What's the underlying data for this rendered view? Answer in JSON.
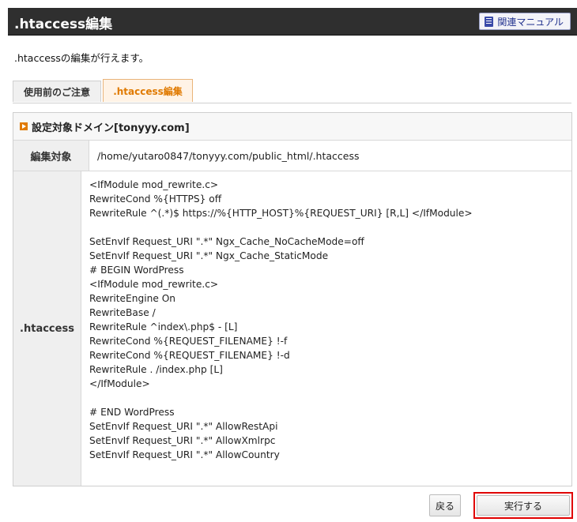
{
  "header": {
    "title": ".htaccess編集",
    "manual_label": "関連マニュアル"
  },
  "description": ".htaccessの編集が行えます。",
  "tabs": [
    {
      "label": "使用前のご注意",
      "active": false
    },
    {
      "label": ".htaccess編集",
      "active": true
    }
  ],
  "panel": {
    "title": "設定対象ドメイン[tonyyy.com]",
    "target_label": "編集対象",
    "target_path": "/home/yutaro0847/tonyyy.com/public_html/.htaccess",
    "htaccess_label": ".htaccess",
    "htaccess_content": "<IfModule mod_rewrite.c>\nRewriteCond %{HTTPS} off\nRewriteRule ^(.*)$ https://%{HTTP_HOST}%{REQUEST_URI} [R,L] </IfModule>\n\nSetEnvIf Request_URI \".*\" Ngx_Cache_NoCacheMode=off\nSetEnvIf Request_URI \".*\" Ngx_Cache_StaticMode\n# BEGIN WordPress\n<IfModule mod_rewrite.c>\nRewriteEngine On\nRewriteBase /\nRewriteRule ^index\\.php$ - [L]\nRewriteCond %{REQUEST_FILENAME} !-f\nRewriteCond %{REQUEST_FILENAME} !-d\nRewriteRule . /index.php [L]\n</IfModule>\n\n# END WordPress\nSetEnvIf Request_URI \".*\" AllowRestApi\nSetEnvIf Request_URI \".*\" AllowXmlrpc\nSetEnvIf Request_URI \".*\" AllowCountry"
  },
  "buttons": {
    "back_label": "戻る",
    "execute_label": "実行する"
  },
  "icons": {
    "manual": "book-icon",
    "domain": "arrow-bullet-icon"
  },
  "colors": {
    "header_bg": "#2f2f2f",
    "accent_orange": "#e07a00",
    "highlight_red": "#e00000"
  }
}
